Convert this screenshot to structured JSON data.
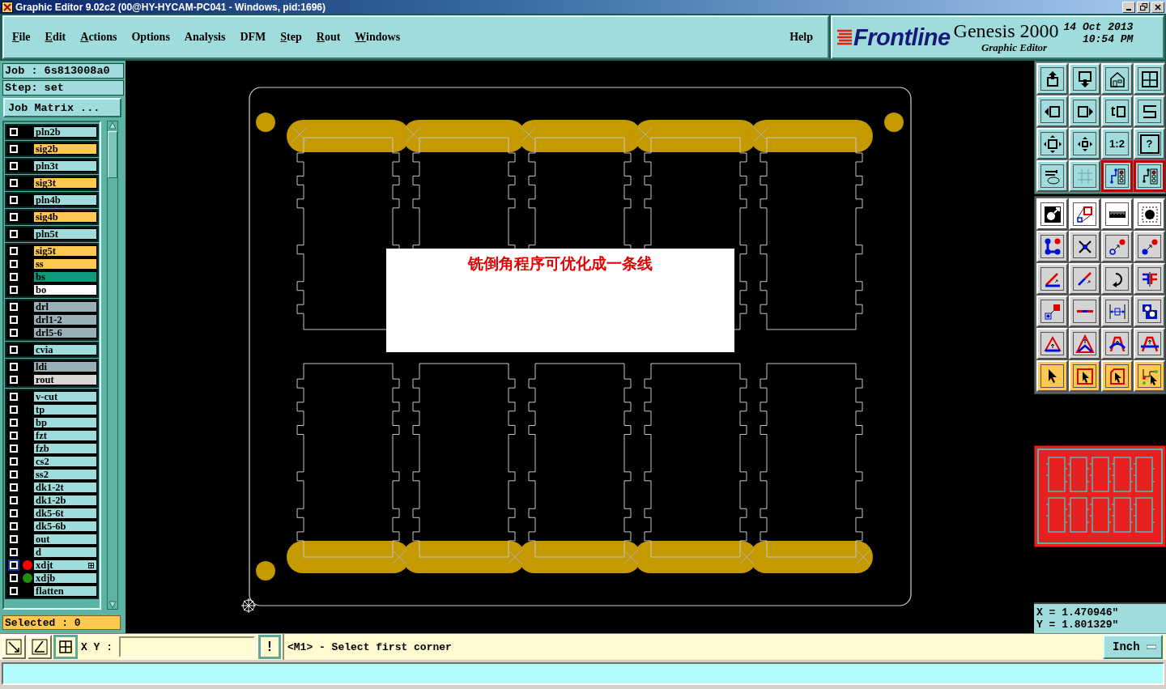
{
  "window": {
    "title": "Graphic Editor 9.02c2 (00@HY-HYCAM-PC041 - Windows, pid:1696)"
  },
  "menu": [
    {
      "label": "File",
      "underlined": true
    },
    {
      "label": "Edit",
      "underlined": true
    },
    {
      "label": "Actions",
      "underlined": true
    },
    {
      "label": "Options",
      "underlined": false
    },
    {
      "label": "Analysis",
      "underlined": false
    },
    {
      "label": "DFM",
      "underlined": false
    },
    {
      "label": "Step",
      "underlined": true
    },
    {
      "label": "Rout",
      "underlined": true
    },
    {
      "label": "Windows",
      "underlined": true
    },
    {
      "label": "Help",
      "underlined": false
    }
  ],
  "logo": {
    "brand": "Frontline",
    "product": "Genesis 2000",
    "subtitle": "Graphic Editor",
    "date": "14 Oct 2013",
    "time": "10:54 PM"
  },
  "job": {
    "job_line": "Job : 6s813008a0",
    "step_line": "Step: set",
    "matrix_button": "Job Matrix ...",
    "selected_count": "Selected : 0"
  },
  "layer_groups": [
    {
      "layers": [
        {
          "name": "pln2b",
          "color": "#a0dcdc",
          "focused": false,
          "marked": false
        }
      ]
    },
    {
      "layers": [
        {
          "name": "sig2b",
          "color": "#ffc850",
          "focused": false,
          "marked": false
        }
      ]
    },
    {
      "layers": [
        {
          "name": "pln3t",
          "color": "#a0dcdc",
          "focused": false,
          "marked": false
        }
      ]
    },
    {
      "layers": [
        {
          "name": "sig3t",
          "color": "#ffc850",
          "focused": false,
          "marked": false
        }
      ]
    },
    {
      "layers": [
        {
          "name": "pln4b",
          "color": "#a0dcdc",
          "focused": false,
          "marked": false
        }
      ]
    },
    {
      "layers": [
        {
          "name": "sig4b",
          "color": "#ffc850",
          "focused": false,
          "marked": false
        }
      ]
    },
    {
      "layers": [
        {
          "name": "pln5t",
          "color": "#a0dcdc",
          "focused": false,
          "marked": false
        }
      ]
    },
    {
      "layers": [
        {
          "name": "sig5t",
          "color": "#ffc850",
          "focused": false,
          "marked": false
        },
        {
          "name": "ss",
          "color": "#ffc850",
          "focused": false,
          "marked": false
        },
        {
          "name": "bs",
          "color": "#10987a",
          "focused": false,
          "marked": false
        },
        {
          "name": "bo",
          "color": "#ffffff",
          "focused": false,
          "marked": false
        }
      ]
    },
    {
      "layers": [
        {
          "name": "drl",
          "color": "#9ab0b8",
          "focused": false,
          "marked": false
        },
        {
          "name": "drl1-2",
          "color": "#9ab0b8",
          "focused": false,
          "marked": false
        },
        {
          "name": "drl5-6",
          "color": "#9ab0b8",
          "focused": false,
          "marked": false
        }
      ]
    },
    {
      "layers": [
        {
          "name": "cvia",
          "color": "#a0dcdc",
          "focused": false,
          "marked": false
        }
      ]
    },
    {
      "layers": [
        {
          "name": "ldi",
          "color": "#9ab0b8",
          "focused": false,
          "marked": false
        },
        {
          "name": "rout",
          "color": "#d8d8d8",
          "focused": false,
          "marked": false
        }
      ]
    },
    {
      "layers": [
        {
          "name": "v-cut",
          "color": "#a0dcdc",
          "focused": false,
          "marked": false
        },
        {
          "name": "tp",
          "color": "#a0dcdc",
          "focused": false,
          "marked": false
        },
        {
          "name": "bp",
          "color": "#a0dcdc",
          "focused": false,
          "marked": false
        },
        {
          "name": "fzt",
          "color": "#a0dcdc",
          "focused": false,
          "marked": false
        },
        {
          "name": "fzb",
          "color": "#a0dcdc",
          "focused": false,
          "marked": false
        },
        {
          "name": "cs2",
          "color": "#a0dcdc",
          "focused": false,
          "marked": false
        },
        {
          "name": "ss2",
          "color": "#a0dcdc",
          "focused": false,
          "marked": false
        },
        {
          "name": "dk1-2t",
          "color": "#a0dcdc",
          "focused": false,
          "marked": false
        },
        {
          "name": "dk1-2b",
          "color": "#a0dcdc",
          "focused": false,
          "marked": false
        },
        {
          "name": "dk5-6t",
          "color": "#a0dcdc",
          "focused": false,
          "marked": false
        },
        {
          "name": "dk5-6b",
          "color": "#a0dcdc",
          "focused": false,
          "marked": false
        },
        {
          "name": "out",
          "color": "#a0dcdc",
          "focused": false,
          "marked": false
        },
        {
          "name": "d",
          "color": "#a0dcdc",
          "focused": false,
          "marked": false
        },
        {
          "name": "xdjt",
          "color": "#a0dcdc",
          "dot": {
            "color": "#ff0000"
          },
          "focused": true,
          "marked": true
        },
        {
          "name": "xdjb",
          "color": "#a0dcdc",
          "dot": {
            "color": "#209010"
          },
          "focused": false,
          "marked": false
        },
        {
          "name": "flatten",
          "color": "#a0dcdc",
          "focused": false,
          "marked": false
        }
      ]
    }
  ],
  "canvas": {
    "note": "铣倒角程序可优化成一条线"
  },
  "toolbar": [
    {
      "kind": "view",
      "selected": false
    },
    {
      "kind": "view",
      "selected": false
    },
    {
      "kind": "view",
      "selected": false
    },
    {
      "kind": "view",
      "selected": false
    },
    {
      "kind": "view",
      "selected": false
    },
    {
      "kind": "view",
      "selected": false
    },
    {
      "kind": "view",
      "selected": false
    },
    {
      "kind": "view",
      "selected": false
    },
    {
      "kind": "view",
      "selected": false
    },
    {
      "kind": "view",
      "selected": false
    },
    {
      "kind": "view",
      "selected": false,
      "label": "1:2"
    },
    {
      "kind": "view",
      "selected": false,
      "label": "?"
    },
    {
      "kind": "view",
      "selected": false
    },
    {
      "kind": "view",
      "selected": false
    },
    {
      "kind": "view",
      "selected": true
    },
    {
      "kind": "view",
      "selected": true
    },
    {
      "kind": "mode",
      "selected": false
    },
    {
      "kind": "mode",
      "selected": false
    },
    {
      "kind": "mode",
      "selected": false
    },
    {
      "kind": "mode",
      "selected": false
    },
    {
      "kind": "edit",
      "selected": false
    },
    {
      "kind": "edit",
      "selected": false
    },
    {
      "kind": "edit",
      "selected": false
    },
    {
      "kind": "edit",
      "selected": false
    },
    {
      "kind": "edit",
      "selected": false
    },
    {
      "kind": "edit",
      "selected": false
    },
    {
      "kind": "edit",
      "selected": false
    },
    {
      "kind": "edit",
      "selected": false
    },
    {
      "kind": "edit",
      "selected": false
    },
    {
      "kind": "edit",
      "selected": false
    },
    {
      "kind": "edit",
      "selected": false
    },
    {
      "kind": "edit",
      "selected": false
    },
    {
      "kind": "edit",
      "selected": false
    },
    {
      "kind": "edit",
      "selected": false
    },
    {
      "kind": "edit",
      "selected": false
    },
    {
      "kind": "edit",
      "selected": false
    },
    {
      "kind": "select",
      "selected": false
    },
    {
      "kind": "select",
      "selected": false
    },
    {
      "kind": "select",
      "selected": false
    },
    {
      "kind": "select",
      "selected": false
    }
  ],
  "coordinates": {
    "x": "X = 1.470946\"",
    "y": "Y = 1.801329\""
  },
  "bottom_tools": [
    {
      "selected": false
    },
    {
      "selected": false
    },
    {
      "selected": true
    }
  ],
  "command": {
    "label": "X Y :",
    "alert_button": "!",
    "message": "<M1> - Select first corner",
    "units_button": "Inch"
  }
}
